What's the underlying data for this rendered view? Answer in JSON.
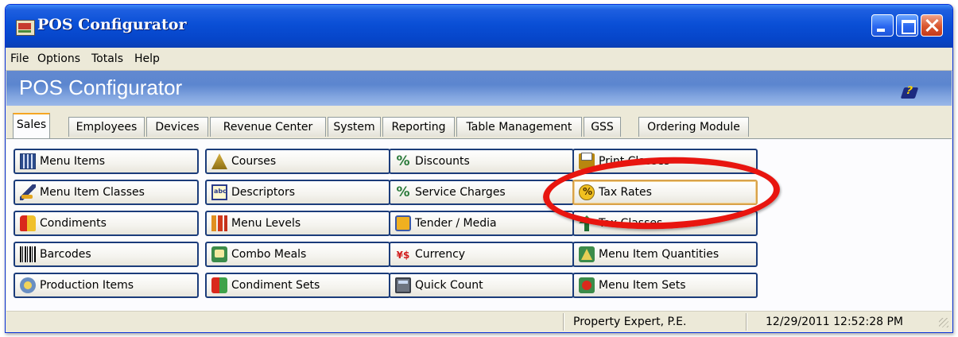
{
  "window": {
    "title": "POS Configurator",
    "controls": [
      "minimize",
      "maximize",
      "close"
    ]
  },
  "menubar": {
    "items": [
      "File",
      "Options",
      "Totals",
      "Help"
    ]
  },
  "banner": {
    "title": "POS Configurator",
    "help_icon": "help-book-icon"
  },
  "tabs": {
    "active": "Sales",
    "items": [
      "Sales",
      "Employees",
      "Devices",
      "Revenue Center",
      "System",
      "Reporting",
      "Table Management",
      "GSS",
      "Ordering Module"
    ]
  },
  "buttons": {
    "menu_items": "Menu Items",
    "menu_item_classes": "Menu Item Classes",
    "condiments": "Condiments",
    "barcodes": "Barcodes",
    "production_items": "Production Items",
    "courses": "Courses",
    "descriptors": "Descriptors",
    "menu_levels": "Menu Levels",
    "combo_meals": "Combo Meals",
    "condiment_sets": "Condiment Sets",
    "discounts": "Discounts",
    "service_charges": "Service Charges",
    "tender_media": "Tender / Media",
    "currency": "Currency",
    "quick_count": "Quick Count",
    "print_classes": "Print Classes",
    "tax_rates": "Tax Rates",
    "tax_classes": "Tax Classes",
    "menu_item_quantities": "Menu Item Quantities",
    "menu_item_sets": "Menu Item Sets"
  },
  "selected_button": "Tax Rates",
  "annotation": {
    "shape": "ellipse",
    "color": "#e8150f",
    "highlights": "Tax Rates"
  },
  "statusbar": {
    "user": "Property Expert, P.E.",
    "datetime": "12/29/2011 12:52:28 PM"
  },
  "colors": {
    "titlebar": "#0a4fd6",
    "banner": "#6289d0",
    "button_border": "#1b3c7a",
    "active_tab_accent": "#f5a623"
  }
}
